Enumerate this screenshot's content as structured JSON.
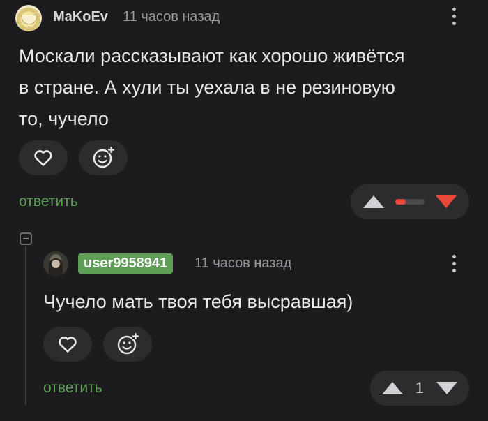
{
  "comment1": {
    "username": "MaKoEv",
    "timestamp": "11 часов назад",
    "text_lines": [
      "Москали рассказывают как хорошо живётся",
      "в стране. А хули ты уехала в не резиновую",
      "то, чучело"
    ],
    "reply_label": "ответить",
    "rating_fraction": 0.35
  },
  "comment2": {
    "username": "user9958941",
    "timestamp": "11 часов назад",
    "text": "Чучело мать твоя тебя высравшая)",
    "reply_label": "ответить",
    "rating": "1"
  },
  "colors": {
    "background": "#1c1c1e",
    "button": "#2c2c2e",
    "accent_green": "#5e9e56",
    "downvote_red": "#e8483a"
  },
  "icons": [
    "avatar",
    "heart-icon",
    "emoji-add-icon",
    "upvote-icon",
    "downvote-icon",
    "more-dots-icon",
    "collapse-icon"
  ]
}
